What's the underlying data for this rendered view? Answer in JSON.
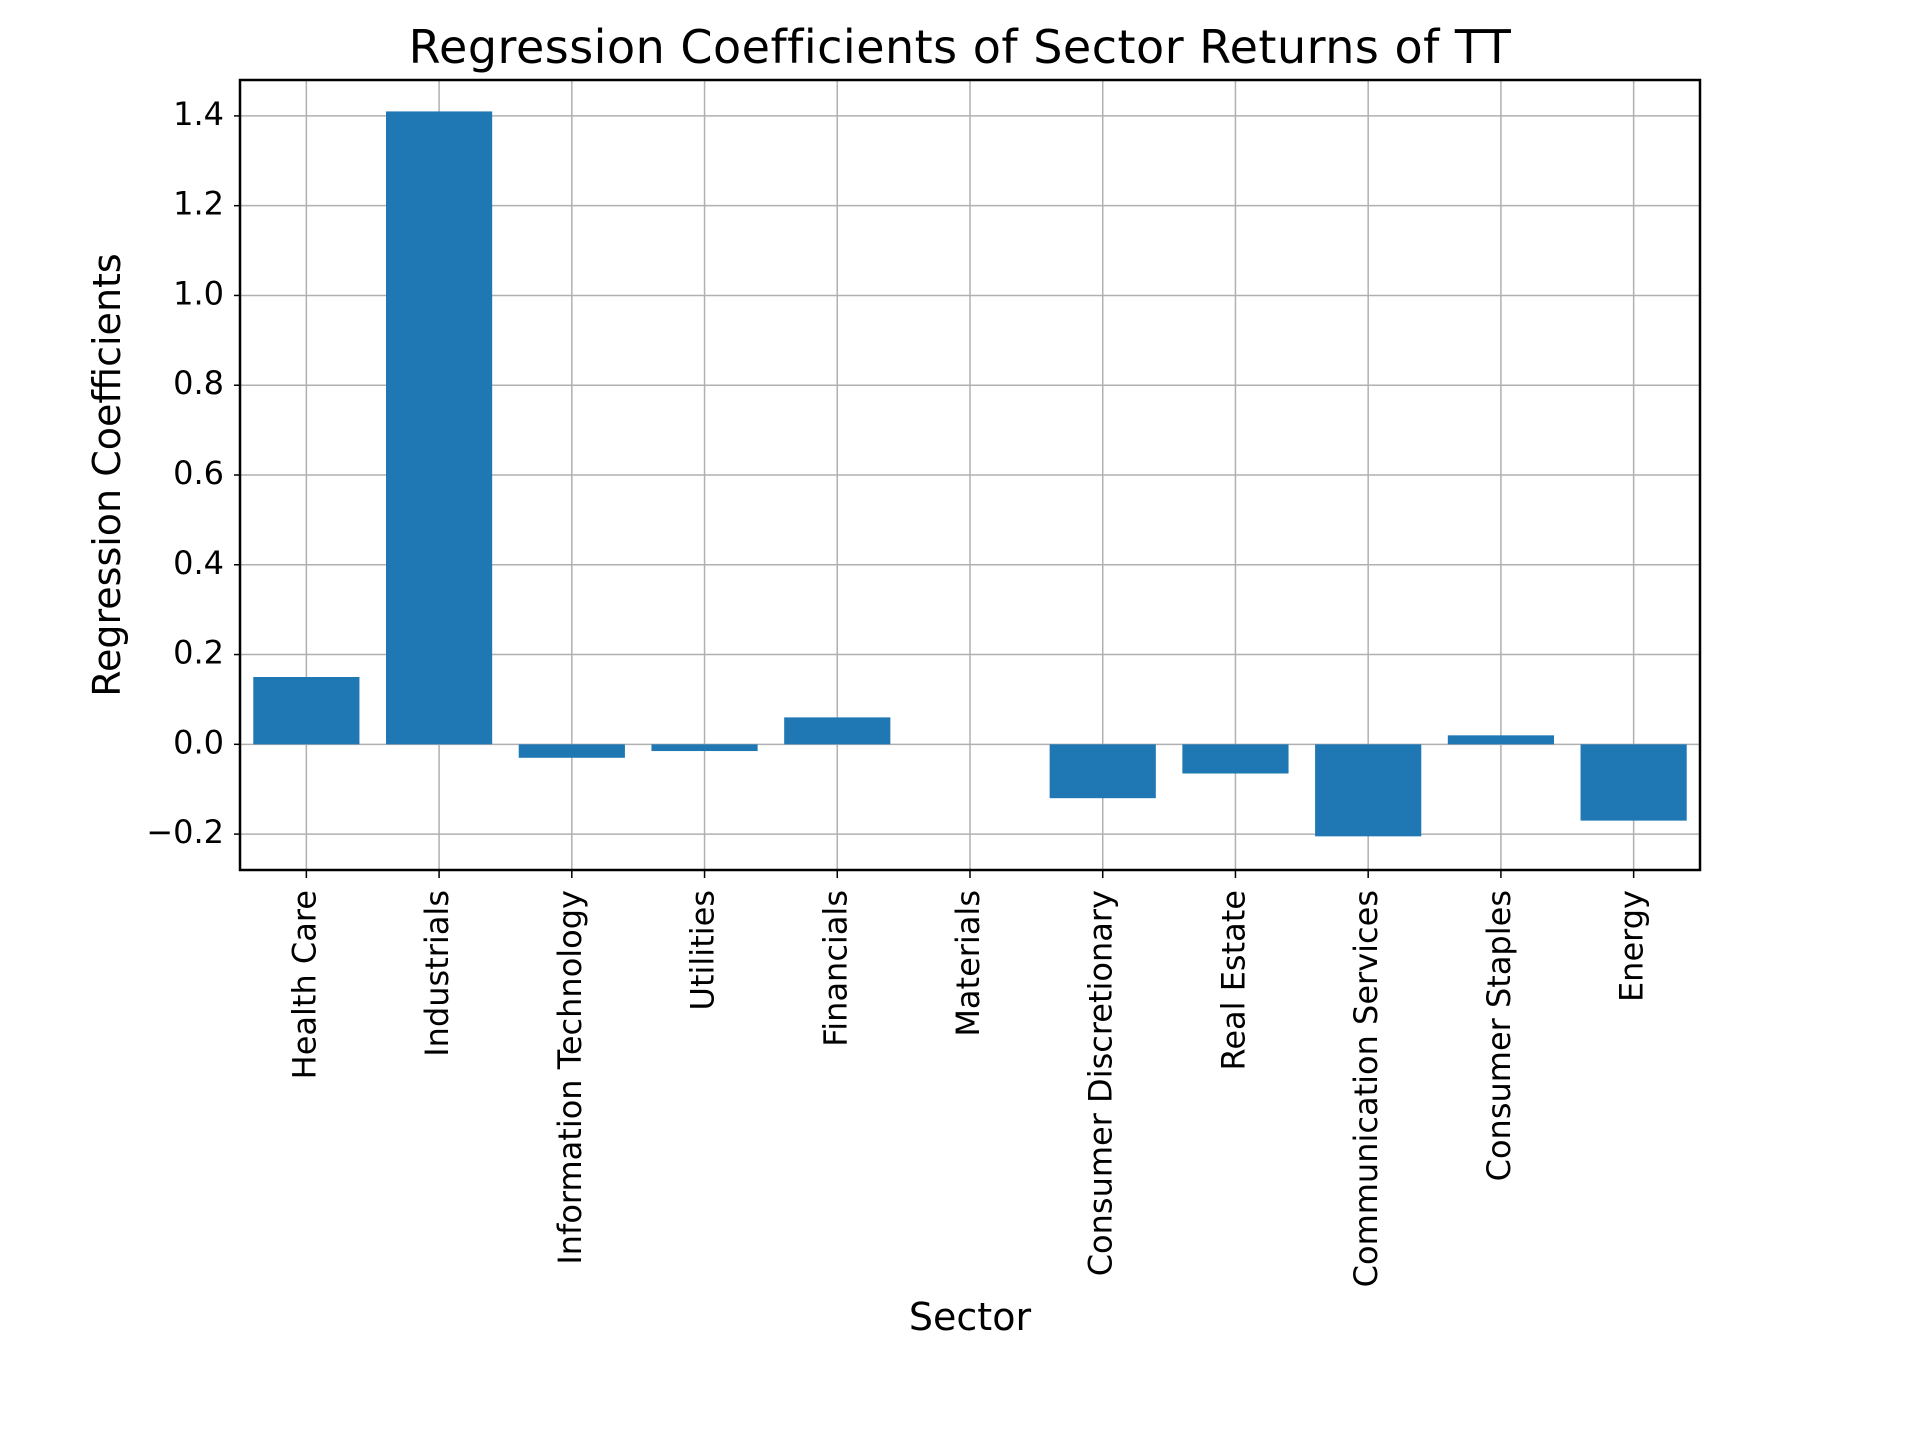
{
  "chart_data": {
    "type": "bar",
    "title": "Regression Coefficients of Sector Returns of TT",
    "xlabel": "Sector",
    "ylabel": "Regression Coefficients",
    "categories": [
      "Health Care",
      "Industrials",
      "Information Technology",
      "Utilities",
      "Financials",
      "Materials",
      "Consumer Discretionary",
      "Real Estate",
      "Communication Services",
      "Consumer Staples",
      "Energy"
    ],
    "values": [
      0.15,
      1.41,
      -0.03,
      -0.015,
      0.06,
      0.0,
      -0.12,
      -0.065,
      -0.205,
      0.02,
      -0.17
    ],
    "ylim": [
      -0.28,
      1.48
    ],
    "y_ticks": [
      -0.2,
      0.0,
      0.2,
      0.4,
      0.6,
      0.8,
      1.0,
      1.2,
      1.4
    ],
    "bar_color": "#1f77b4"
  }
}
